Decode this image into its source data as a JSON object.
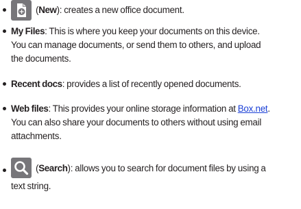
{
  "items": [
    {
      "icon": "new-document-icon",
      "open": "(",
      "term": "New",
      "close": ")",
      "desc": ": creates a new office document."
    },
    {
      "term": "My Files",
      "lines": [
        ": This is where you keep your documents on this device.",
        "You can manage documents, or send them to others, and upload",
        "the documents."
      ]
    },
    {
      "term": "Recent docs",
      "desc": ": provides a list of recently opened documents."
    },
    {
      "term": "Web files",
      "line1_before_link": ": This provides your online storage information at ",
      "link": "Box.net",
      "line1_after_link": ".",
      "lines": [
        "You can also share your documents to others without using email",
        "attachments."
      ]
    },
    {
      "icon": "search-icon",
      "open": "(",
      "term": "Search",
      "close": ")",
      "desc": ": allows you to search for document files by using a",
      "line2": "text string."
    }
  ],
  "colors": {
    "text": "#231f20",
    "icon_background": "#77767a",
    "link": "#1a3fd6"
  }
}
